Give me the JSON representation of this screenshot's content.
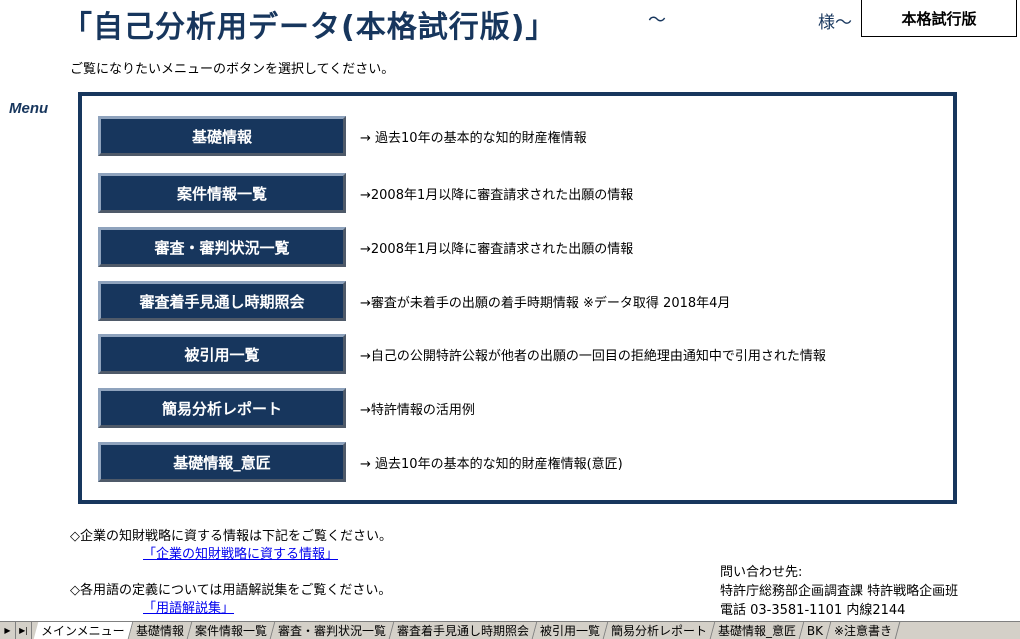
{
  "header": {
    "title": "「自己分析用データ(本格試行版)」",
    "tilde": "～",
    "sama": "様～",
    "badge": "本格試行版"
  },
  "instruction": "ご覧になりたいメニューのボタンを選択してください。",
  "menu_label": "Menu",
  "menu": [
    {
      "label": "基礎情報",
      "desc": "→ 過去10年の基本的な知的財産権情報"
    },
    {
      "label": "案件情報一覧",
      "desc": "→2008年1月以降に審査請求された出願の情報"
    },
    {
      "label": "審査・審判状況一覧",
      "desc": "→2008年1月以降に審査請求された出願の情報"
    },
    {
      "label": "審査着手見通し時期照会",
      "desc": "→審査が未着手の出願の着手時期情報 ※データ取得 2018年4月"
    },
    {
      "label": "被引用一覧",
      "desc": "→自己の公開特許公報が他者の出願の一回目の拒絶理由通知中で引用された情報"
    },
    {
      "label": "簡易分析レポート",
      "desc": "→特許情報の活用例"
    },
    {
      "label": "基礎情報_意匠",
      "desc": "→ 過去10年の基本的な知的財産権情報(意匠)"
    }
  ],
  "notes": {
    "strategy_text": "◇企業の知財戦略に資する情報は下記をご覧ください。",
    "strategy_link": "「企業の知財戦略に資する情報」",
    "glossary_text": "◇各用語の定義については用語解説集をご覧ください。",
    "glossary_link": "「用語解説集」"
  },
  "contact": {
    "heading": "問い合わせ先:",
    "dept": "特許庁総務部企画調査課 特許戦略企画班",
    "phone": "電話 03-3581-1101 内線2144"
  },
  "tabs": {
    "nav_last": "▶|",
    "nav_next": "▶",
    "items": [
      "メインメニュー",
      "基礎情報",
      "案件情報一覧",
      "審査・審判状況一覧",
      "審査着手見通し時期照会",
      "被引用一覧",
      "簡易分析レポート",
      "基礎情報_意匠",
      "BK",
      "※注意書き"
    ]
  }
}
